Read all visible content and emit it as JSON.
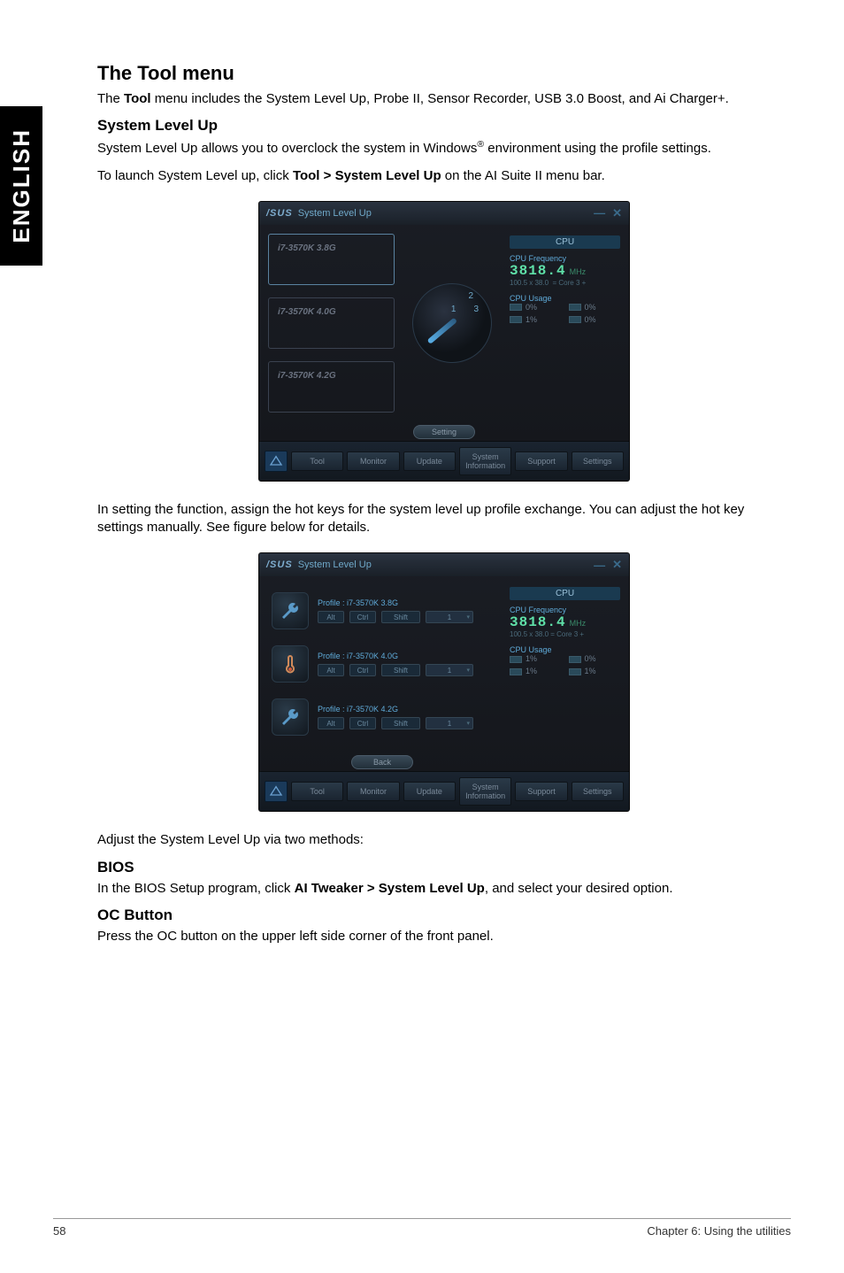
{
  "side_tab": "ENGLISH",
  "headings": {
    "tool_menu": "The Tool menu",
    "system_level_up": "System Level Up",
    "bios": "BIOS",
    "oc_button": "OC Button"
  },
  "paragraphs": {
    "tool_intro_1": "The ",
    "tool_intro_bold": "Tool",
    "tool_intro_2": " menu includes the System Level Up, Probe II, Sensor Recorder, USB 3.0 Boost, and Ai Charger+.",
    "slu_intro": "System Level Up allows you to overclock the system in Windows",
    "slu_sup": "®",
    "slu_intro_2": " environment using the profile settings.",
    "slu_launch_1": "To launch System Level up, click ",
    "slu_launch_bold": "Tool > System Level Up",
    "slu_launch_2": " on the AI Suite II menu bar.",
    "setting_para": "In setting the function, assign the hot keys for the system level up profile exchange.  You can adjust the hot key settings manually. See figure below for details.",
    "adjust_para": "Adjust the System Level Up via two methods:",
    "bios_para_1": "In the BIOS Setup program, click ",
    "bios_para_bold": "AI Tweaker > System Level Up",
    "bios_para_2": ", and select your desired option.",
    "oc_para": "Press the OC button on the upper left side corner of the front panel."
  },
  "win1": {
    "brand": "/SUS",
    "title": "System Level Up",
    "profiles": [
      "i7-3570K 3.8G",
      "i7-3570K 4.0G",
      "i7-3570K 4.2G"
    ],
    "dial_marks": [
      "1",
      "2",
      "3"
    ],
    "setting_btn": "Setting",
    "cpu_header": "CPU",
    "cpu_freq_label": "CPU Frequency",
    "cpu_freq_val": "3818.4",
    "cpu_freq_unit": "MHz",
    "cpu_freq_sub1": "100.5 x 38.0",
    "cpu_freq_sub2": "= Core 3  +",
    "cpu_usage_label": "CPU Usage",
    "usage_cells": [
      "0%",
      "0%",
      "1%",
      "0%"
    ],
    "footer_buttons": [
      "Tool",
      "Monitor",
      "Update",
      "System Information",
      "Support",
      "Settings"
    ]
  },
  "win2": {
    "brand": "/SUS",
    "title": "System Level Up",
    "rows": [
      {
        "label": "Profile : i7-3570K 3.8G"
      },
      {
        "label": "Profile : i7-3570K 4.0G"
      },
      {
        "label": "Profile : i7-3570K 4.2G"
      }
    ],
    "row_inputs": {
      "a": "Alt",
      "b": "Ctrl",
      "c": "Shift",
      "d": "1"
    },
    "back_btn": "Back",
    "cpu_header": "CPU",
    "cpu_freq_label": "CPU Frequency",
    "cpu_freq_val": "3818.4",
    "cpu_freq_unit": "MHz",
    "cpu_freq_sub": "100.5 x 38.0   =  Core 3  +",
    "cpu_usage_label": "CPU Usage",
    "usage_cells": [
      "1%",
      "0%",
      "1%",
      "1%"
    ],
    "footer_buttons": [
      "Tool",
      "Monitor",
      "Update",
      "System Information",
      "Support",
      "Settings"
    ]
  },
  "footer": {
    "page": "58",
    "chapter": "Chapter 6: Using the utilities"
  }
}
